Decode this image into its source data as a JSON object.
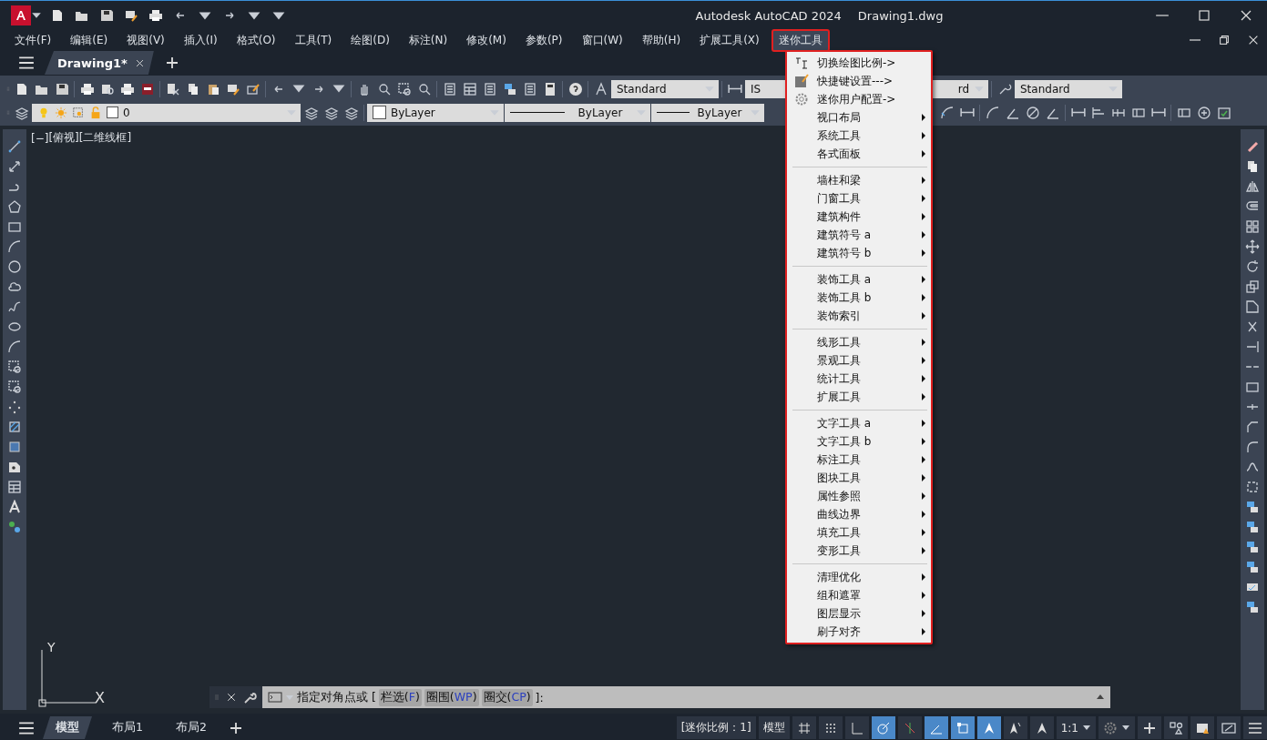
{
  "title_bar": {
    "app": "Autodesk AutoCAD 2024",
    "document": "Drawing1.dwg"
  },
  "menu_bar": [
    {
      "label": "文件(F)",
      "selected": false
    },
    {
      "label": "编辑(E)",
      "selected": false
    },
    {
      "label": "视图(V)",
      "selected": false
    },
    {
      "label": "插入(I)",
      "selected": false
    },
    {
      "label": "格式(O)",
      "selected": false
    },
    {
      "label": "工具(T)",
      "selected": false
    },
    {
      "label": "绘图(D)",
      "selected": false
    },
    {
      "label": "标注(N)",
      "selected": false
    },
    {
      "label": "修改(M)",
      "selected": false
    },
    {
      "label": "参数(P)",
      "selected": false
    },
    {
      "label": "窗口(W)",
      "selected": false
    },
    {
      "label": "帮助(H)",
      "selected": false
    },
    {
      "label": "扩展工具(X)",
      "selected": false
    },
    {
      "label": "迷你工具",
      "selected": true
    }
  ],
  "document_tabs": [
    {
      "label": "Drawing1*",
      "selected": true
    }
  ],
  "toolbar": {
    "text_style": "Standard",
    "dim_style": "IS",
    "table_style": "rd",
    "multileader_style": "Standard"
  },
  "properties_bar": {
    "layer": "0",
    "object_color": "ByLayer",
    "linetype": "ByLayer",
    "lineweight": "ByLayer"
  },
  "viewport_controls": [
    "[−]",
    "[俯视]",
    "[二维线框]"
  ],
  "ucs": {
    "y": "Y",
    "x": "X"
  },
  "command_line": {
    "prompt": "指定对角点或 [",
    "options": [
      {
        "label": "栏选(",
        "key": "F",
        "end": ")"
      },
      {
        "label": "圈围(",
        "key": "WP",
        "end": ")"
      },
      {
        "label": "圈交(",
        "key": "CP",
        "end": ")"
      }
    ],
    "end": "]:"
  },
  "layout_tabs": [
    {
      "label": "模型",
      "selected": true
    },
    {
      "label": "布局1",
      "selected": false
    },
    {
      "label": "布局2",
      "selected": false
    }
  ],
  "status_bar": {
    "scale_note": "[迷你比例：1]",
    "space": "模型",
    "toggles": [
      {
        "kind": "grid",
        "on": false
      },
      {
        "kind": "snap",
        "on": false
      },
      {
        "kind": "ortho",
        "on": false
      },
      {
        "kind": "polar",
        "on": true
      },
      {
        "kind": "isodraft",
        "on": false
      },
      {
        "kind": "tracking",
        "on": true
      },
      {
        "kind": "osnap",
        "on": true
      },
      {
        "kind": "annovisible",
        "on": true
      },
      {
        "kind": "autoscale",
        "on": false
      },
      {
        "kind": "annoscale",
        "on": false
      }
    ],
    "annotation_scale": "1:1"
  },
  "dropdown_menu": {
    "groups": [
      [
        {
          "label": "切换绘图比例->",
          "kind": "command"
        },
        {
          "label": "快捷键设置--->",
          "kind": "command"
        },
        {
          "label": "迷你用户配置->",
          "kind": "command"
        },
        {
          "label": "视口布局",
          "kind": "submenu"
        },
        {
          "label": "系统工具",
          "kind": "submenu"
        },
        {
          "label": "各式面板",
          "kind": "submenu"
        }
      ],
      [
        {
          "label": "墙柱和梁",
          "kind": "submenu"
        },
        {
          "label": "门窗工具",
          "kind": "submenu"
        },
        {
          "label": "建筑构件",
          "kind": "submenu"
        },
        {
          "label": "建筑符号 a",
          "kind": "submenu"
        },
        {
          "label": "建筑符号 b",
          "kind": "submenu"
        }
      ],
      [
        {
          "label": "装饰工具 a",
          "kind": "submenu"
        },
        {
          "label": "装饰工具 b",
          "kind": "submenu"
        },
        {
          "label": "装饰索引",
          "kind": "submenu"
        }
      ],
      [
        {
          "label": "线形工具",
          "kind": "submenu"
        },
        {
          "label": "景观工具",
          "kind": "submenu"
        },
        {
          "label": "统计工具",
          "kind": "submenu"
        },
        {
          "label": "扩展工具",
          "kind": "submenu"
        }
      ],
      [
        {
          "label": "文字工具 a",
          "kind": "submenu"
        },
        {
          "label": "文字工具 b",
          "kind": "submenu"
        },
        {
          "label": "标注工具",
          "kind": "submenu"
        },
        {
          "label": "图块工具",
          "kind": "submenu"
        },
        {
          "label": "属性参照",
          "kind": "submenu"
        },
        {
          "label": "曲线边界",
          "kind": "submenu"
        },
        {
          "label": "填充工具",
          "kind": "submenu"
        },
        {
          "label": "变形工具",
          "kind": "submenu"
        }
      ],
      [
        {
          "label": "清理优化",
          "kind": "submenu"
        },
        {
          "label": "组和遮罩",
          "kind": "submenu"
        },
        {
          "label": "图层显示",
          "kind": "submenu"
        },
        {
          "label": "刷子对齐",
          "kind": "submenu"
        }
      ]
    ]
  }
}
